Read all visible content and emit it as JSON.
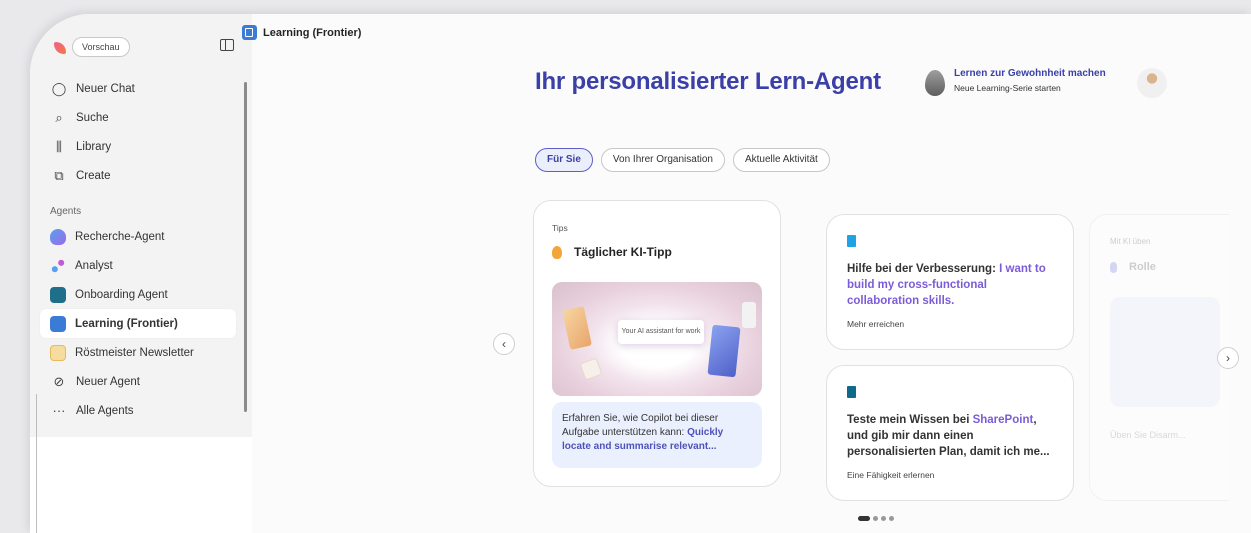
{
  "topbar": {
    "preview_label": "Vorschau"
  },
  "sidebar": {
    "items": [
      {
        "label": "Neuer Chat",
        "icon": "chat-bubble-icon"
      },
      {
        "label": "Suche",
        "icon": "search-icon"
      },
      {
        "label": "Library",
        "icon": "library-icon"
      },
      {
        "label": "Create",
        "icon": "create-icon"
      }
    ],
    "agents_label": "Agents",
    "agents": [
      {
        "label": "Recherche-Agent",
        "color": "#6a7df0"
      },
      {
        "label": "Analyst",
        "color": "#7b5cd6"
      },
      {
        "label": "Onboarding Agent",
        "color": "#1f6f8b"
      },
      {
        "label": "Learning (Frontier)",
        "color": "#3a7bd5"
      },
      {
        "label": "Röstmeister Newsletter",
        "color": "#f2c46b"
      },
      {
        "label": "Neuer Agent",
        "icon": "new-agent-icon"
      },
      {
        "label": "Alle Agents",
        "icon": "more-icon"
      }
    ]
  },
  "header": {
    "app_title": "Learning (Frontier)"
  },
  "main": {
    "title": "Ihr personalisierter Lern-Agent",
    "streak": {
      "title": "Lernen zur Gewohnheit machen",
      "subtitle": "Neue Learning-Serie starten"
    },
    "tabs": [
      {
        "label": "Für Sie",
        "selected": true
      },
      {
        "label": "Von Ihrer Organisation"
      },
      {
        "label": "Aktuelle Aktivität"
      }
    ],
    "cards": {
      "tips": {
        "label": "Tips",
        "title": "Täglicher KI-Tipp",
        "image_text": "Your AI assistant for work",
        "desc_prefix": "Erfahren Sie, wie Copilot bei dieser Aufgabe unterstützen kann: ",
        "desc_highlight": "Quickly locate and summarise relevant..."
      },
      "help": {
        "prefix": "Hilfe bei der Verbesserung: ",
        "highlight": "I want to build my cross-functional collaboration skills.",
        "footer": "Mehr erreichen",
        "icon_color": "#1fa3e6"
      },
      "test": {
        "prefix": "Teste mein Wissen bei ",
        "highlight": "SharePoint",
        "suffix": ", und gib mir dann einen personalisierten Plan, damit ich me...",
        "footer": "Eine Fähigkeit erlernen",
        "icon_color": "#0f6a8a"
      },
      "faded": {
        "label": "Mit KI üben",
        "title": "Rolle",
        "footer": "Üben Sie Disarm..."
      }
    },
    "carousel": {
      "pages": 4,
      "active": 0
    }
  },
  "colors": {
    "accent": "#5b5fc7",
    "title": "#3b3fa8"
  }
}
